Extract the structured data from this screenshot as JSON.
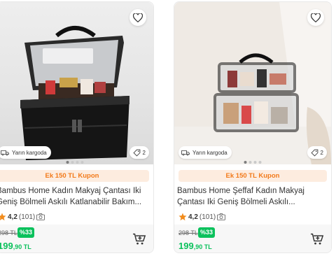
{
  "products": [
    {
      "title_line1": "Bambus Home Kadın Makyaj Çantası Iki",
      "title_line2": "Geniş Bölmeli Askılı Katlanabilir Bakım...",
      "shipping": "Yarın kargoda",
      "count": "2",
      "coupon": "Ek 150 TL Kupon",
      "rating": "4,2",
      "reviews": "(101)",
      "old_price": "298 TL",
      "discount": "%33",
      "price_main": "199",
      "price_cents": ",90 TL",
      "icons": [
        "heart-icon",
        "truck-icon",
        "tag-icon",
        "star-icon",
        "camera-icon",
        "cart-plus-icon"
      ]
    },
    {
      "title_line1": "Bambus Home Şeffaf Kadın Makyaj",
      "title_line2": "Çantası Iki Geniş Bölmeli Askılı...",
      "shipping": "Yarın kargoda",
      "count": "2",
      "coupon": "Ek 150 TL Kupon",
      "rating": "4,2",
      "reviews": "(101)",
      "old_price": "298 TL",
      "discount": "%33",
      "price_main": "199",
      "price_cents": ",90 TL",
      "icons": [
        "heart-icon",
        "truck-icon",
        "tag-icon",
        "star-icon",
        "camera-icon",
        "cart-plus-icon"
      ]
    }
  ],
  "colors": {
    "accent_orange": "#f27a1a",
    "price_green": "#0bc15c",
    "coupon_bg": "#fdecdf"
  }
}
